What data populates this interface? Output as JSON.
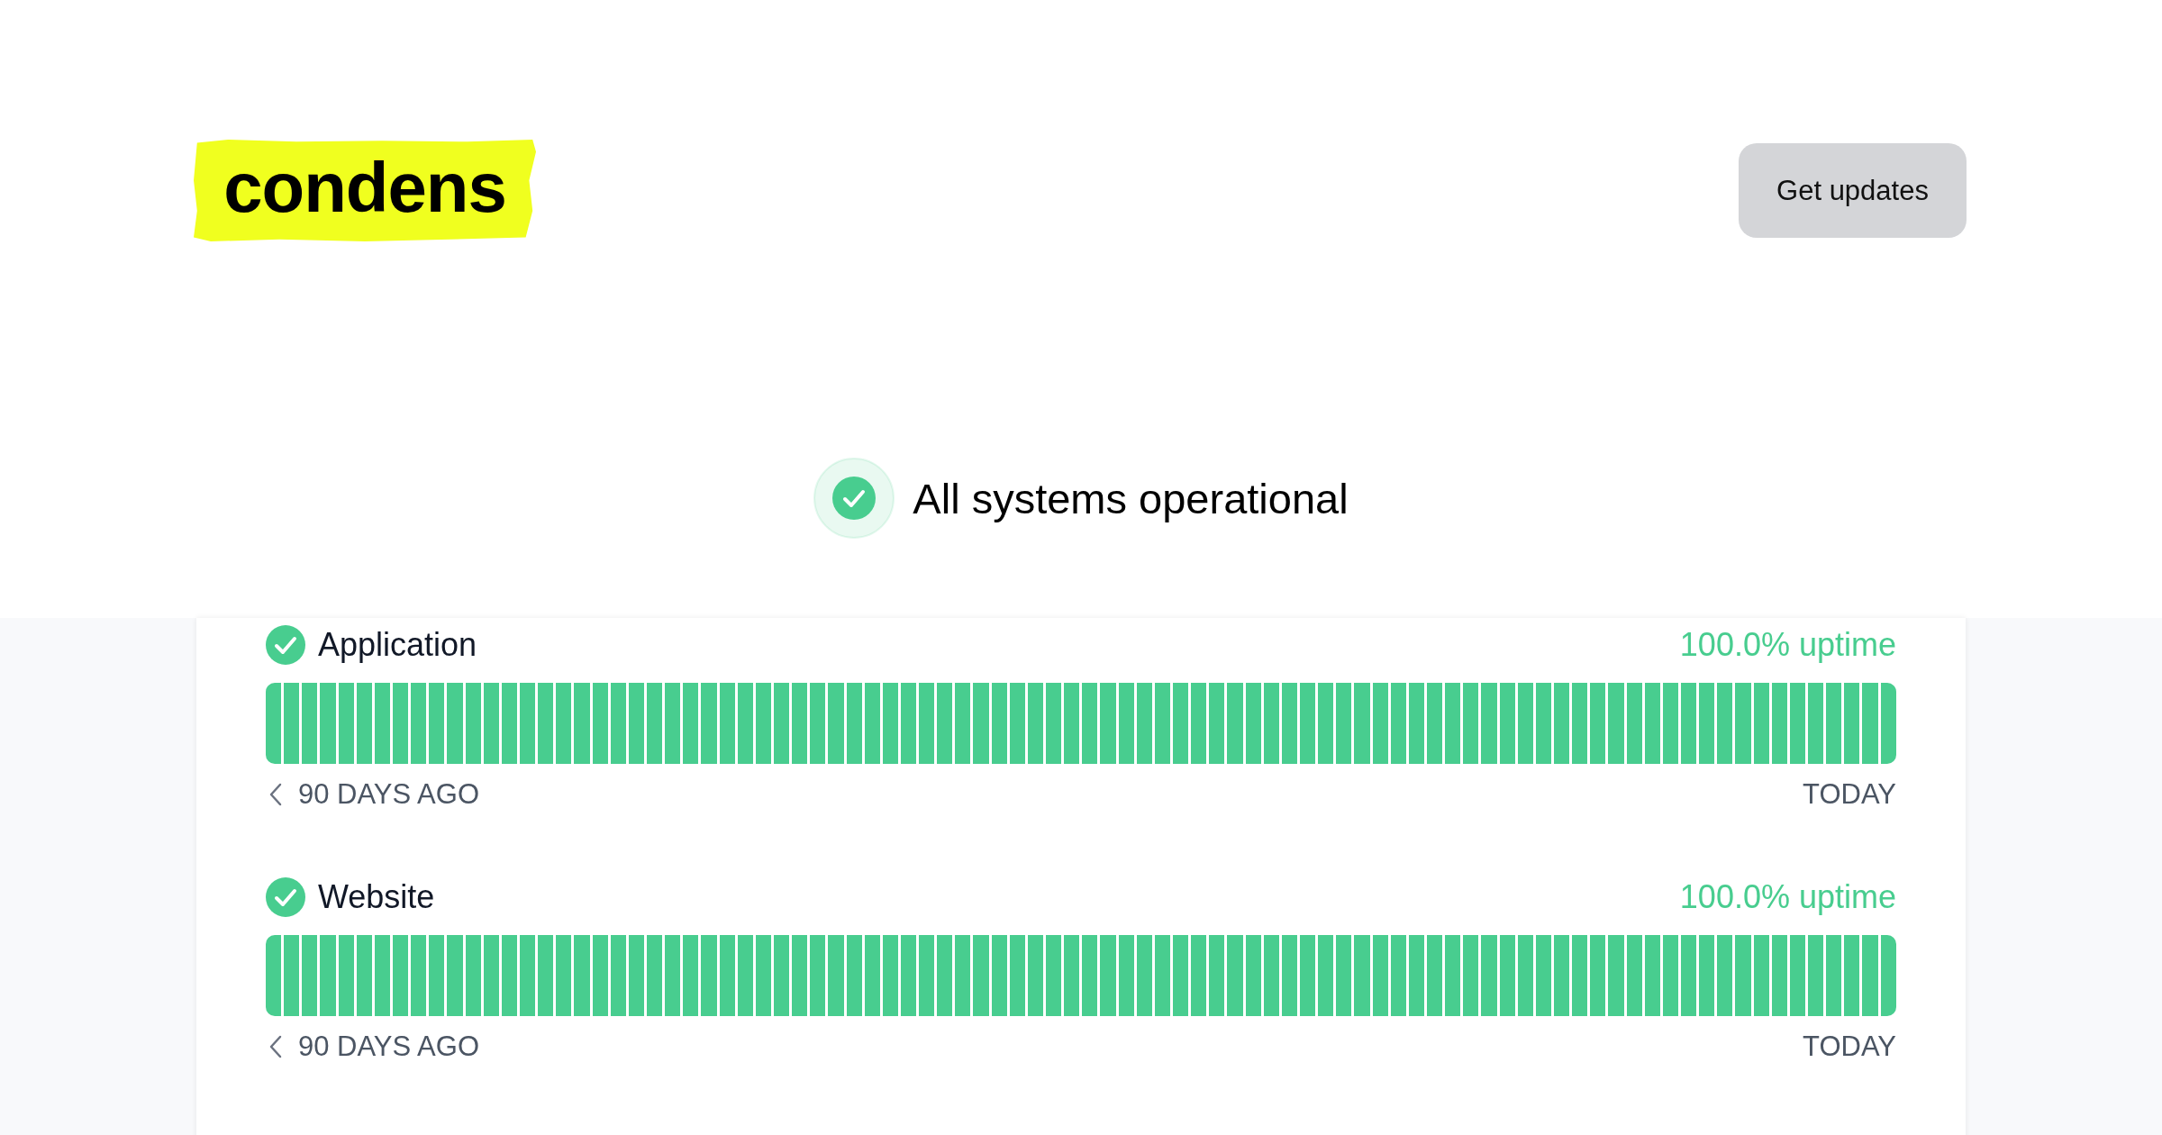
{
  "logo": {
    "text": "condens"
  },
  "header": {
    "button": "Get updates"
  },
  "overall_status": {
    "operational": true,
    "text": "All systems operational"
  },
  "services": [
    {
      "name": "Application",
      "operational": true,
      "uptime": "100.0% uptime",
      "start_label": "90 DAYS AGO",
      "end_label": "TODAY",
      "days": [
        {
          "up": true
        },
        {
          "up": true
        },
        {
          "up": true
        },
        {
          "up": true
        },
        {
          "up": true
        },
        {
          "up": true
        },
        {
          "up": true
        },
        {
          "up": true
        },
        {
          "up": true
        },
        {
          "up": true
        },
        {
          "up": true
        },
        {
          "up": true
        },
        {
          "up": true
        },
        {
          "up": true
        },
        {
          "up": true
        },
        {
          "up": true
        },
        {
          "up": true
        },
        {
          "up": true
        },
        {
          "up": true
        },
        {
          "up": true
        },
        {
          "up": true
        },
        {
          "up": true
        },
        {
          "up": true
        },
        {
          "up": true
        },
        {
          "up": true
        },
        {
          "up": true
        },
        {
          "up": true
        },
        {
          "up": true
        },
        {
          "up": true
        },
        {
          "up": true
        },
        {
          "up": true
        },
        {
          "up": true
        },
        {
          "up": true
        },
        {
          "up": true
        },
        {
          "up": true
        },
        {
          "up": true
        },
        {
          "up": true
        },
        {
          "up": true
        },
        {
          "up": true
        },
        {
          "up": true
        },
        {
          "up": true
        },
        {
          "up": true
        },
        {
          "up": true
        },
        {
          "up": true
        },
        {
          "up": true
        },
        {
          "up": true
        },
        {
          "up": true
        },
        {
          "up": true
        },
        {
          "up": true
        },
        {
          "up": true
        },
        {
          "up": true
        },
        {
          "up": true
        },
        {
          "up": true
        },
        {
          "up": true
        },
        {
          "up": true
        },
        {
          "up": true
        },
        {
          "up": true
        },
        {
          "up": true
        },
        {
          "up": true
        },
        {
          "up": true
        },
        {
          "up": true
        },
        {
          "up": true
        },
        {
          "up": true
        },
        {
          "up": true
        },
        {
          "up": true
        },
        {
          "up": true
        },
        {
          "up": true
        },
        {
          "up": true
        },
        {
          "up": true
        },
        {
          "up": true
        },
        {
          "up": true
        },
        {
          "up": true
        },
        {
          "up": true
        },
        {
          "up": true
        },
        {
          "up": true
        },
        {
          "up": true
        },
        {
          "up": true
        },
        {
          "up": true
        },
        {
          "up": true
        },
        {
          "up": true
        },
        {
          "up": true
        },
        {
          "up": true
        },
        {
          "up": true
        },
        {
          "up": true
        },
        {
          "up": true
        },
        {
          "up": true
        },
        {
          "up": true
        },
        {
          "up": true
        },
        {
          "up": true
        },
        {
          "up": true
        }
      ]
    },
    {
      "name": "Website",
      "operational": true,
      "uptime": "100.0% uptime",
      "start_label": "90 DAYS AGO",
      "end_label": "TODAY",
      "days": [
        {
          "up": true
        },
        {
          "up": true
        },
        {
          "up": true
        },
        {
          "up": true
        },
        {
          "up": true
        },
        {
          "up": true
        },
        {
          "up": true
        },
        {
          "up": true
        },
        {
          "up": true
        },
        {
          "up": true
        },
        {
          "up": true
        },
        {
          "up": true
        },
        {
          "up": true
        },
        {
          "up": true
        },
        {
          "up": true
        },
        {
          "up": true
        },
        {
          "up": true
        },
        {
          "up": true
        },
        {
          "up": true
        },
        {
          "up": true
        },
        {
          "up": true
        },
        {
          "up": true
        },
        {
          "up": true
        },
        {
          "up": true
        },
        {
          "up": true
        },
        {
          "up": true
        },
        {
          "up": true
        },
        {
          "up": true
        },
        {
          "up": true
        },
        {
          "up": true
        },
        {
          "up": true
        },
        {
          "up": true
        },
        {
          "up": true
        },
        {
          "up": true
        },
        {
          "up": true
        },
        {
          "up": true
        },
        {
          "up": true
        },
        {
          "up": true
        },
        {
          "up": true
        },
        {
          "up": true
        },
        {
          "up": true
        },
        {
          "up": true
        },
        {
          "up": true
        },
        {
          "up": true
        },
        {
          "up": true
        },
        {
          "up": true
        },
        {
          "up": true
        },
        {
          "up": true
        },
        {
          "up": true
        },
        {
          "up": true
        },
        {
          "up": true
        },
        {
          "up": true
        },
        {
          "up": true
        },
        {
          "up": true
        },
        {
          "up": true
        },
        {
          "up": true
        },
        {
          "up": true
        },
        {
          "up": true
        },
        {
          "up": true
        },
        {
          "up": true
        },
        {
          "up": true
        },
        {
          "up": true
        },
        {
          "up": true
        },
        {
          "up": true
        },
        {
          "up": true
        },
        {
          "up": true
        },
        {
          "up": true
        },
        {
          "up": true
        },
        {
          "up": true
        },
        {
          "up": true
        },
        {
          "up": true
        },
        {
          "up": true
        },
        {
          "up": true
        },
        {
          "up": true
        },
        {
          "up": true
        },
        {
          "up": true
        },
        {
          "up": true
        },
        {
          "up": true
        },
        {
          "up": true
        },
        {
          "up": true
        },
        {
          "up": true
        },
        {
          "up": true
        },
        {
          "up": true
        },
        {
          "up": true
        },
        {
          "up": true
        },
        {
          "up": true
        },
        {
          "up": true
        },
        {
          "up": true
        },
        {
          "up": true
        },
        {
          "up": true
        }
      ]
    }
  ]
}
